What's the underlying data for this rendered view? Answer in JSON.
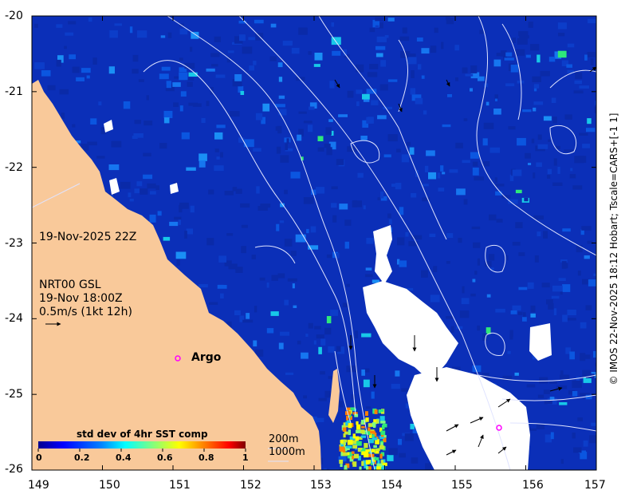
{
  "map": {
    "lat_ticks": [
      "-20",
      "-21",
      "-22",
      "-23",
      "-24",
      "-25",
      "-26"
    ],
    "lon_ticks": [
      "149",
      "150",
      "151",
      "152",
      "153",
      "154",
      "155",
      "156",
      "157"
    ],
    "lat_range": [
      -26,
      -20
    ],
    "lon_range": [
      149,
      157
    ],
    "land_color": "#f9c99a",
    "nodata_color": "#ffffff",
    "ocean_base_color": "#0b2fb8"
  },
  "overlay": {
    "date": "19-Nov-2025 22Z",
    "model": "NRT00 GSL",
    "model_time": "19-Nov 18:00Z",
    "scale": "0.5m/s (1kt 12h)",
    "argo_label": "Argo"
  },
  "colorbar": {
    "title": "std dev of 4hr SST comp",
    "range": [
      0,
      1
    ],
    "ticks": [
      "0",
      "0.2",
      "0.4",
      "0.6",
      "0.8",
      "1"
    ],
    "colors": [
      "#00008f",
      "#0000ff",
      "#0080ff",
      "#00ffff",
      "#80ff80",
      "#ffff00",
      "#ff8000",
      "#ff0000",
      "#800000"
    ]
  },
  "contours": {
    "label_200": "200m",
    "label_1000": "1000m"
  },
  "credit": "© IMOS 22-Nov-2025 18:12 Hobart; Tscale=CARS+[-1 1]"
}
